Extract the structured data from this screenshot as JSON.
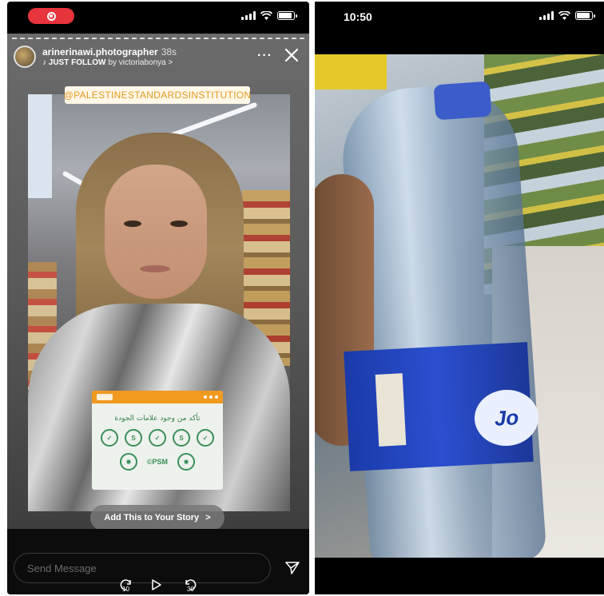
{
  "left": {
    "status": {
      "record_indicator": "record-icon"
    },
    "story": {
      "username": "arinerinawi.photographer",
      "time": "38s",
      "music": "♪ JUST FOLLOW",
      "by": "by victoriabonya >",
      "more": "···",
      "mention": "@PALESTINESTANDARDSINSTITUTION",
      "card_title": "تأكد من وجود علامات الجودة",
      "badges_row1": [
        "✓",
        "S",
        "✓",
        "S",
        "✓"
      ],
      "badge_psm": "©PSM",
      "add_to_story": "Add This to Your Story",
      "add_chevron": ">"
    },
    "bottom": {
      "message_placeholder": "Send Message",
      "rewind": "10",
      "forward": "30"
    }
  },
  "right": {
    "clock": "10:50",
    "bottle_brand_fragment": "Jo"
  },
  "colors": {
    "record_red": "#e8343d",
    "mention_orange": "#e59b1f",
    "card_orange": "#f09a1f",
    "badge_green": "#3a8f5a",
    "label_blue": "#2b4fd0"
  }
}
